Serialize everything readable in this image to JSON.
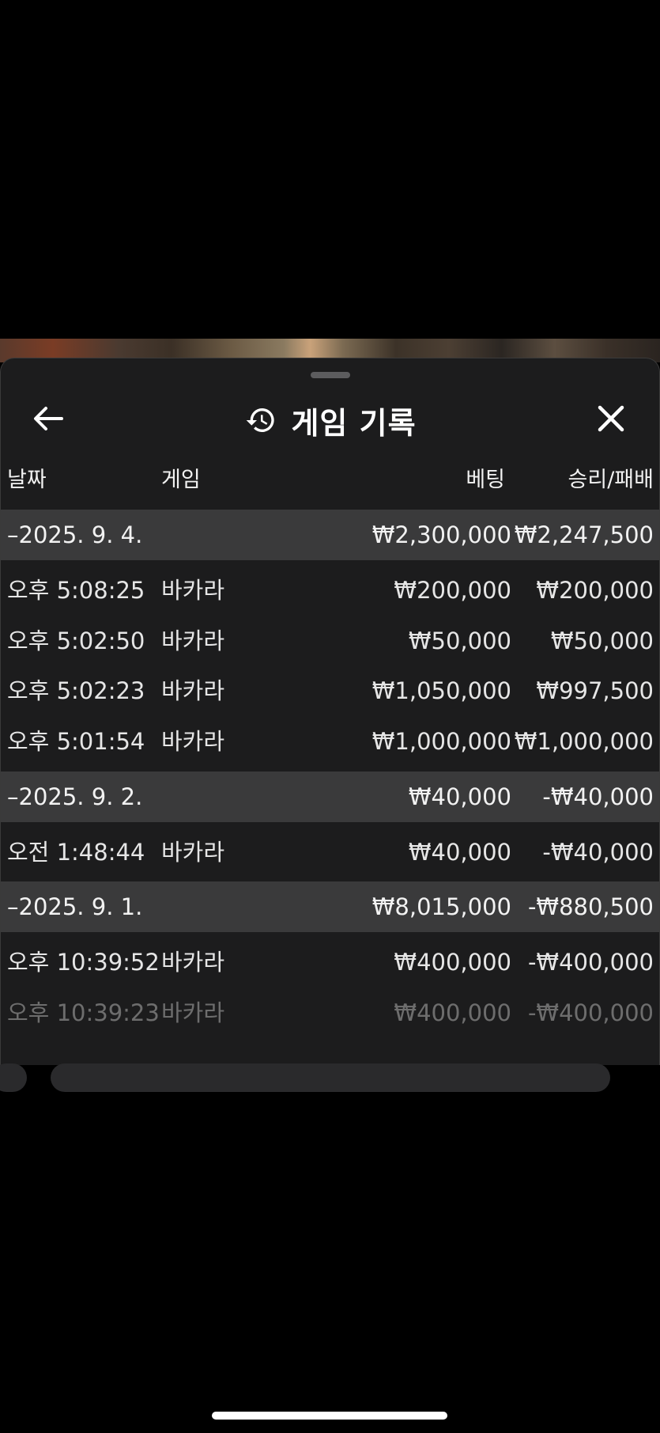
{
  "header": {
    "title": "게임 기록",
    "back_icon": "arrow-left-icon",
    "history_icon": "history-icon",
    "close_icon": "close-icon"
  },
  "columns": {
    "date": "날짜",
    "game": "게임",
    "bet": "베팅",
    "result": "승리/패배"
  },
  "groups": [
    {
      "date": "–2025. 9. 4.",
      "bet": "₩2,300,000",
      "result": "₩2,247,500",
      "rows": [
        {
          "time": "오후 5:08:25",
          "game": "바카라",
          "bet": "₩200,000",
          "result": "₩200,000"
        },
        {
          "time": "오후 5:02:50",
          "game": "바카라",
          "bet": "₩50,000",
          "result": "₩50,000"
        },
        {
          "time": "오후 5:02:23",
          "game": "바카라",
          "bet": "₩1,050,000",
          "result": "₩997,500"
        },
        {
          "time": "오후 5:01:54",
          "game": "바카라",
          "bet": "₩1,000,000",
          "result": "₩1,000,000"
        }
      ]
    },
    {
      "date": "–2025. 9. 2.",
      "bet": "₩40,000",
      "result": "-₩40,000",
      "rows": [
        {
          "time": "오전 1:48:44",
          "game": "바카라",
          "bet": "₩40,000",
          "result": "-₩40,000"
        }
      ]
    },
    {
      "date": "–2025. 9. 1.",
      "bet": "₩8,015,000",
      "result": "-₩880,500",
      "rows": [
        {
          "time": "오후 10:39:52",
          "game": "바카라",
          "bet": "₩400,000",
          "result": "-₩400,000"
        },
        {
          "time": "오후 10:39:23",
          "game": "바카라",
          "bet": "₩400,000",
          "result": "-₩400,000"
        }
      ]
    }
  ],
  "colors": {
    "sheet_background": "#1c1c1d",
    "group_background": "#3a3a3b",
    "text": "#e6e6e6"
  }
}
